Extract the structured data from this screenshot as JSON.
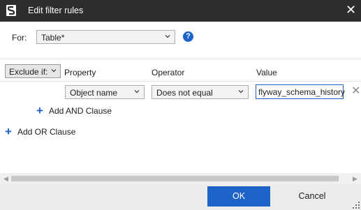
{
  "window": {
    "title": "Edit filter rules"
  },
  "for_row": {
    "label": "For:",
    "selected": "Table*"
  },
  "rule": {
    "exclude_mode": "Exclude if:",
    "headers": {
      "property": "Property",
      "operator": "Operator",
      "value": "Value"
    },
    "property": "Object name",
    "operator": "Does not equal",
    "value": "flyway_schema_history"
  },
  "actions": {
    "add_and": "Add AND Clause",
    "add_or": "Add OR Clause"
  },
  "buttons": {
    "ok": "OK",
    "cancel": "Cancel"
  },
  "colors": {
    "accent": "#1e63c8",
    "titlebar": "#2d2d30"
  }
}
